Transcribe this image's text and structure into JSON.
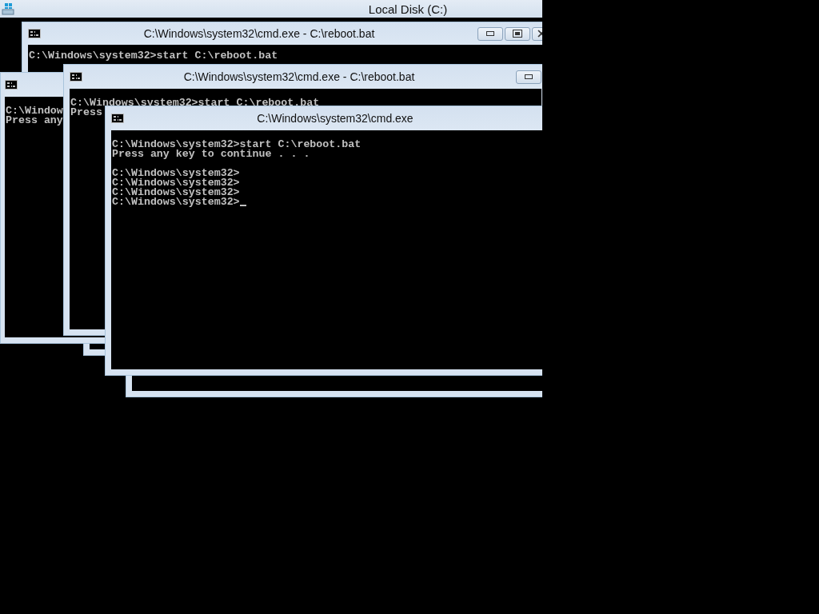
{
  "windows": [
    {
      "kind": "explorer",
      "title": "Local Disk (C:)"
    },
    {
      "kind": "frame"
    },
    {
      "kind": "frame"
    },
    {
      "kind": "console",
      "title": "C:\\Windows\\system32\\cmd.exe - C:\\reboot.bat",
      "buttons": [
        {
          "kind": "minimize"
        },
        {
          "kind": "maximize"
        },
        {
          "kind": "close"
        }
      ],
      "blocks": [
        [
          "C:\\Windows\\system32>start C:\\reboot.bat"
        ]
      ]
    },
    {
      "kind": "console",
      "blocks": [
        [
          "C:\\Window",
          "Press any"
        ]
      ]
    },
    {
      "kind": "console",
      "title": "C:\\Windows\\system32\\cmd.exe - C:\\reboot.bat",
      "buttons": [
        {
          "kind": "minimize"
        }
      ],
      "blocks": [
        [
          "C:\\Windows\\system32>start C:\\reboot.bat",
          "Press"
        ]
      ]
    },
    {
      "kind": "console",
      "title": "C:\\Windows\\system32\\cmd.exe",
      "cursor": true,
      "blocks": [
        [
          "C:\\Windows\\system32>start C:\\reboot.bat",
          "Press any key to continue . . ."
        ],
        [
          "C:\\Windows\\system32>",
          "C:\\Windows\\system32>",
          "C:\\Windows\\system32>",
          "C:\\Windows\\system32>"
        ]
      ]
    }
  ]
}
